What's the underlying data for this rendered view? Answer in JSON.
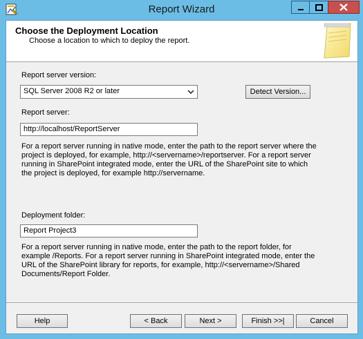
{
  "window": {
    "title": "Report Wizard"
  },
  "header": {
    "title": "Choose the Deployment Location",
    "subtitle": "Choose a location to which to deploy the report."
  },
  "version": {
    "label": "Report server version:",
    "selected": "SQL Server 2008 R2 or later",
    "detect_button": "Detect Version..."
  },
  "server": {
    "label": "Report server:",
    "value": "http://localhost/ReportServer",
    "help_lines": [
      "For a report server running in native mode, enter the path to the report server where the",
      "project is deployed, for example, http://<servername>/reportserver. For a report server",
      "running in SharePoint integrated mode, enter the URL of the SharePoint site to which",
      "the project is deployed, for example http://servername."
    ]
  },
  "folder": {
    "label": "Deployment folder:",
    "value": "Report Project3",
    "help_lines": [
      "For a report server running in native mode, enter the path to the report folder, for",
      "example /Reports. For a report server running in SharePoint integrated mode, enter the",
      "URL of the SharePoint library for reports, for example, http://<servername>/Shared",
      "Documents/Report Folder."
    ]
  },
  "buttons": {
    "help": "Help",
    "back": "< Back",
    "next": "Next >",
    "finish": "Finish >>|",
    "cancel": "Cancel"
  }
}
